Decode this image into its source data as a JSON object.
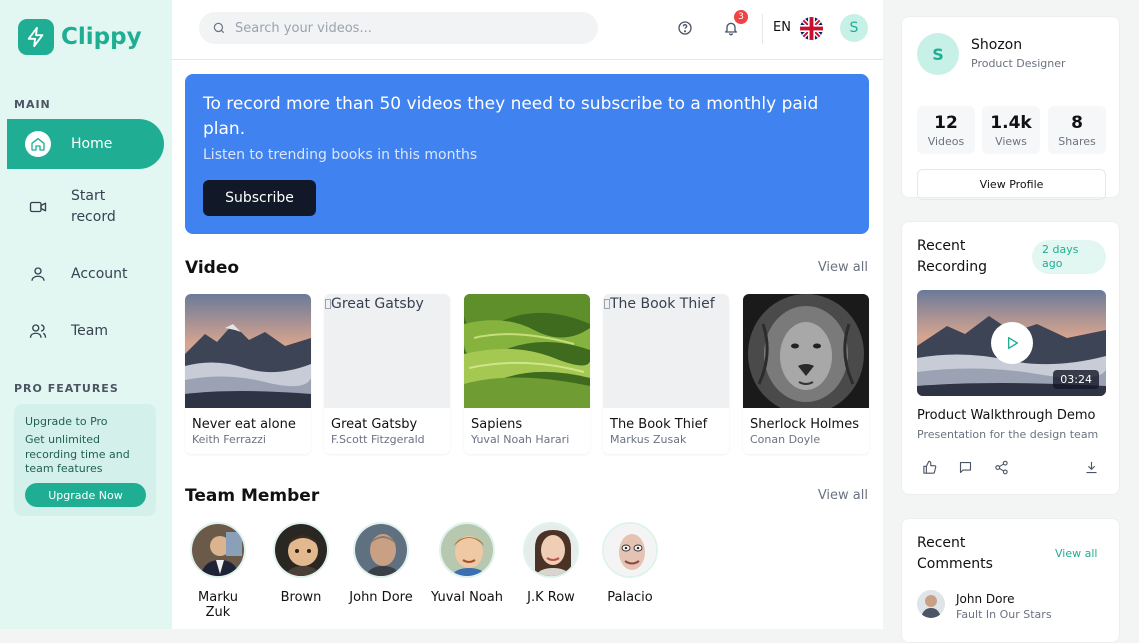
{
  "app": {
    "name": "Clippy",
    "brand_color": "#1fae93"
  },
  "sidebar": {
    "main_label": "MAIN",
    "items": [
      {
        "label": "Home",
        "icon": "home-icon",
        "active": true
      },
      {
        "label": "Start record",
        "line1": "Start",
        "line2": "record",
        "icon": "video-camera-icon"
      },
      {
        "label": "Account",
        "icon": "user-icon"
      },
      {
        "label": "Team",
        "icon": "users-icon"
      }
    ],
    "pro_label": "PRO FEATURES",
    "pro": {
      "title": "Upgrade to Pro",
      "desc": "Get unlimited recording time and team features",
      "button": "Upgrade Now"
    }
  },
  "topbar": {
    "search_placeholder": "Search your videos...",
    "notification_count": "3",
    "language": "EN",
    "avatar_initial": "S"
  },
  "banner": {
    "title": "To record more than 50 videos they need to subscribe to a monthly paid plan.",
    "subtitle": "Listen to trending books in this months",
    "button": "Subscribe",
    "color": "#3f82f0"
  },
  "videos": {
    "heading": "Video",
    "view_all": "View all",
    "items": [
      {
        "title": "Never eat alone",
        "author": "Keith Ferrazzi",
        "alt": ""
      },
      {
        "title": "Great Gatsby",
        "author": "F.Scott Fitzgerald",
        "alt": "Great Gatsby"
      },
      {
        "title": "Sapiens",
        "author": "Yuval Noah Harari",
        "alt": ""
      },
      {
        "title": "The Book Thief",
        "author": "Markus Zusak",
        "alt": "The Book Thief"
      },
      {
        "title": "Sherlock Holmes",
        "author": "Conan Doyle",
        "alt": ""
      }
    ]
  },
  "team": {
    "heading": "Team Member",
    "view_all": "View all",
    "members": [
      {
        "name": "Marku Zuk"
      },
      {
        "name": "Brown"
      },
      {
        "name": "John Dore"
      },
      {
        "name": "Yuval Noah"
      },
      {
        "name": "J.K Row"
      },
      {
        "name": "Palacio"
      }
    ]
  },
  "profile": {
    "initial": "S",
    "name": "Shozon",
    "role": "Product Designer",
    "stats": [
      {
        "value": "12",
        "label": "Videos"
      },
      {
        "value": "1.4k",
        "label": "Views"
      },
      {
        "value": "8",
        "label": "Shares"
      }
    ],
    "button": "View Profile"
  },
  "recent_recording": {
    "heading_line1": "Recent",
    "heading_line2": "Recording",
    "time_badge_line1": "2 days",
    "time_badge_line2": "ago",
    "duration": "03:24",
    "title": "Product Walkthrough Demo",
    "subtitle": "Presentation for the design team"
  },
  "recent_comments": {
    "heading_line1": "Recent",
    "heading_line2": "Comments",
    "view_all": "View all",
    "items": [
      {
        "name": "John Dore",
        "text": "Fault In Our Stars"
      }
    ]
  }
}
